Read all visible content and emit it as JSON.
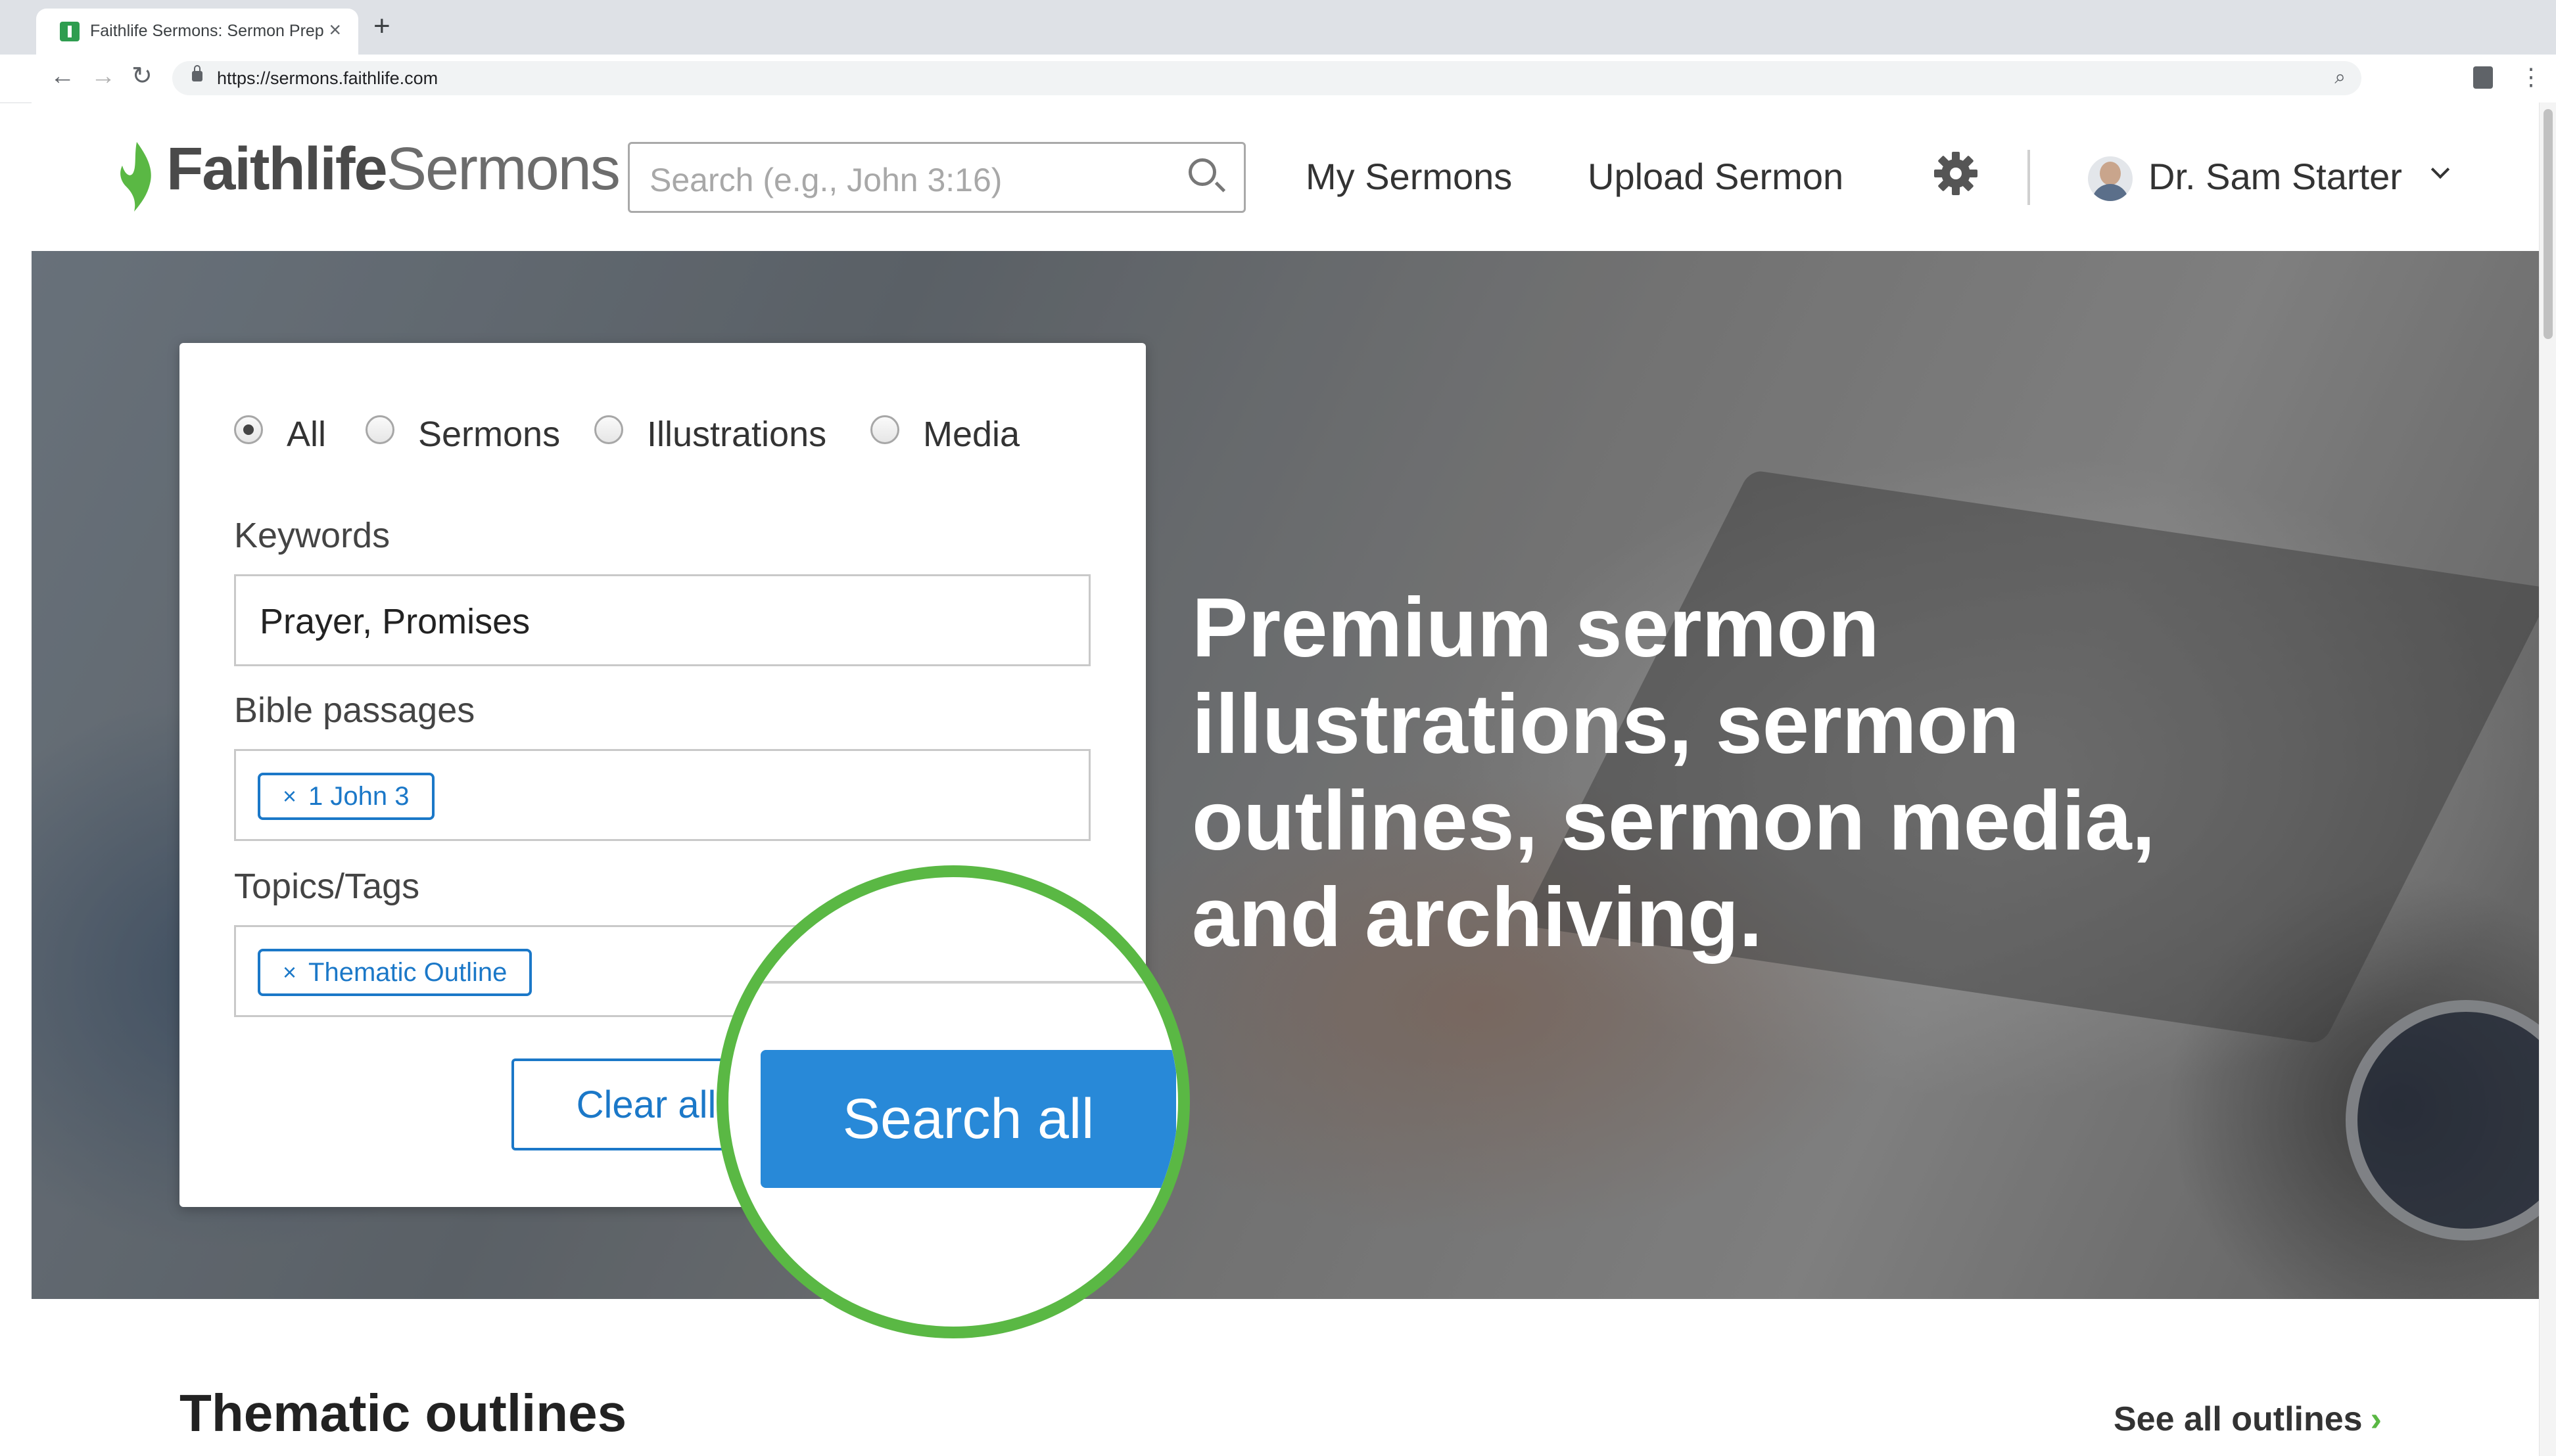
{
  "browser": {
    "tab_title": "Faithlife Sermons: Sermon Prep",
    "tab_close": "×",
    "new_tab": "+",
    "url": "https://sermons.faithlife.com",
    "back": "←",
    "forward": "→",
    "reload": "↻",
    "zoom_icon": "⌕",
    "menu_icon": "⋮"
  },
  "header": {
    "logo_part1": "Faithlife",
    "logo_part2": "Sermons",
    "search_placeholder": "Search (e.g., John 3:16)",
    "nav": {
      "my_sermons": "My Sermons",
      "upload_sermon": "Upload Sermon"
    },
    "user_name": "Dr. Sam Starter"
  },
  "search_panel": {
    "types": [
      {
        "label": "All",
        "selected": true
      },
      {
        "label": "Sermons",
        "selected": false
      },
      {
        "label": "Illustrations",
        "selected": false
      },
      {
        "label": "Media",
        "selected": false
      }
    ],
    "keywords_label": "Keywords",
    "keywords_value": "Prayer, Promises",
    "bible_label": "Bible passages",
    "bible_chip": "1 John 3",
    "topics_label": "Topics/Tags",
    "topics_chip": "Thematic Outline",
    "chip_remove": "×",
    "clear_label": "Clear all",
    "search_label": "Search all"
  },
  "hero": {
    "line1": "Premium sermon",
    "line2": "illustrations, sermon",
    "line3": "outlines, sermon media,",
    "line4": "and archiving."
  },
  "below": {
    "section_title": "Thematic outlines",
    "see_all": "See all outlines",
    "see_all_arrow": "›"
  },
  "colors": {
    "brand_green": "#5ab844",
    "accent_blue": "#2889d8",
    "chip_blue": "#1b78c8"
  }
}
